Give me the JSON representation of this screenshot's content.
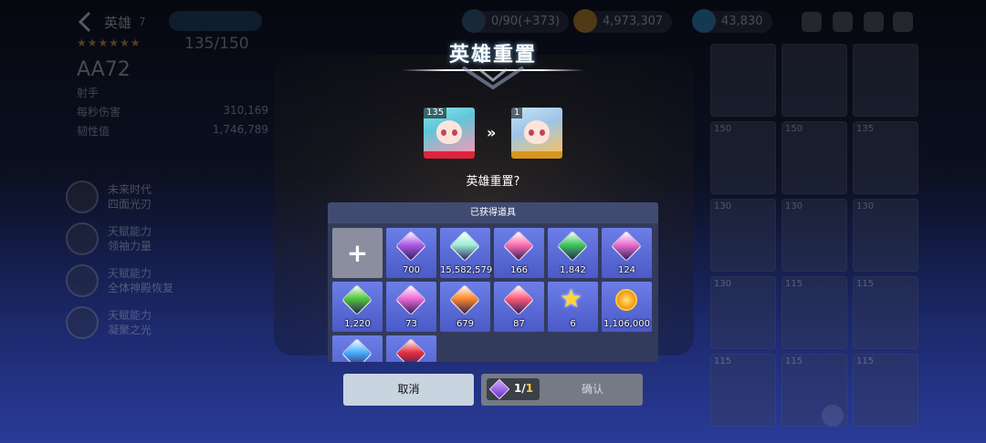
{
  "background": {
    "title": "英雄",
    "title_count": "7",
    "resources": [
      {
        "value": "0/90(+373)",
        "color": "#3d6b8f"
      },
      {
        "value": "4,973,307",
        "color": "#e6a020"
      },
      {
        "value": "43,830",
        "color": "#34a0d8"
      }
    ],
    "hero": {
      "level": "135/150",
      "name": "AA72",
      "role": "射手",
      "stats": [
        {
          "label": "每秒伤害",
          "value": "310,169"
        },
        {
          "label": "韧性值",
          "value": "1,746,789"
        }
      ]
    },
    "skills": [
      {
        "line1": "未来时代",
        "line2": "四面光刃"
      },
      {
        "line1": "天赋能力",
        "line2": "领袖力量"
      },
      {
        "line1": "天赋能力",
        "line2": "全体神殿恢复"
      },
      {
        "line1": "天赋能力",
        "line2": "凝聚之光"
      }
    ],
    "grid_levels": [
      "",
      "",
      "",
      "150",
      "150",
      "135",
      "130",
      "130",
      "130",
      "130",
      "115",
      "115",
      "115",
      "115",
      "115"
    ]
  },
  "dialog": {
    "title": "英雄重置",
    "from_level": "135",
    "to_level": "1",
    "from_stars": "★★★★★★",
    "to_stars": "★★★★",
    "question": "英雄重置?",
    "panel_header": "已获得道具",
    "add_label": "+",
    "items": [
      {
        "icon": "purple-gem-icon",
        "color": "#b05ae8",
        "qty": "700"
      },
      {
        "icon": "crystal-icon",
        "color": "#9ef0d8",
        "qty": "15,582,579"
      },
      {
        "icon": "rainbow-gem-icon",
        "color": "#ff6fb0",
        "qty": "166"
      },
      {
        "icon": "green-red-gem-icon",
        "color": "#3fc85a",
        "qty": "1,842"
      },
      {
        "icon": "pink-gem-icon",
        "color": "#e86fd0",
        "qty": "124"
      },
      {
        "icon": "rainbow-crest-icon",
        "color": "#52c83a",
        "qty": "1,220"
      },
      {
        "icon": "prism-gem-icon",
        "color": "#f06ad8",
        "qty": "73"
      },
      {
        "icon": "flower-gem-icon",
        "color": "#ff8a2a",
        "qty": "679"
      },
      {
        "icon": "fire-gem-icon",
        "color": "#ff5a7a",
        "qty": "87"
      },
      {
        "icon": "star-icon",
        "color": "#ffd43a",
        "qty": "6"
      },
      {
        "icon": "gold-coin-icon",
        "color": "#f6a21a",
        "qty": "1,106,000"
      },
      {
        "icon": "blue-gem-icon",
        "color": "#4ab0ff",
        "qty": ""
      },
      {
        "icon": "red-gem-icon",
        "color": "#e83040",
        "qty": ""
      }
    ],
    "cancel_label": "取消",
    "cost_current": "1/",
    "cost_max": "1",
    "confirm_label": "确认"
  }
}
